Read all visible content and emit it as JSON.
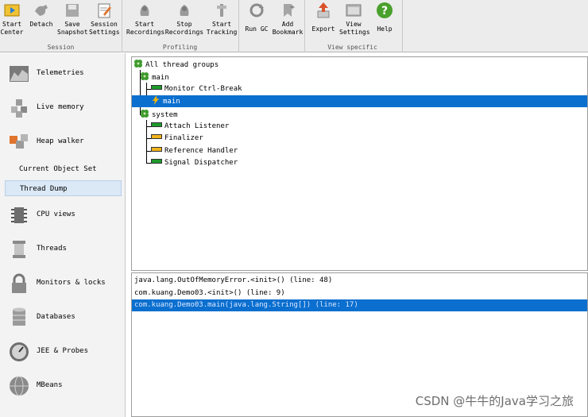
{
  "toolbar": {
    "groups": {
      "session": "Session",
      "profiling": "Profiling",
      "view_specific": "View specific"
    },
    "buttons": {
      "start_center": "Start\nCenter",
      "detach": "Detach",
      "save_snapshot": "Save\nSnapshot",
      "session_settings": "Session\nSettings",
      "start_recordings": "Start\nRecordings",
      "stop_recordings": "Stop\nRecordings",
      "start_tracking": "Start\nTracking",
      "run_gc": "Run GC",
      "add_bookmark": "Add\nBookmark",
      "export": "Export",
      "view_settings": "View\nSettings",
      "help": "Help"
    }
  },
  "sidebar": {
    "items": {
      "telemetries": "Telemetries",
      "live_memory": "Live memory",
      "heap_walker": "Heap walker",
      "current_object_set": "Current Object Set",
      "thread_dump": "Thread Dump",
      "cpu_views": "CPU views",
      "threads": "Threads",
      "monitors_locks": "Monitors & locks",
      "databases": "Databases",
      "jee_probes": "JEE & Probes",
      "mbeans": "MBeans"
    }
  },
  "tree": {
    "root": "All thread groups",
    "main_group": "main",
    "monitor_ctrl_break": "Monitor Ctrl-Break",
    "main_thread": "main",
    "system_group": "system",
    "attach_listener": "Attach Listener",
    "finalizer": "Finalizer",
    "reference_handler": "Reference Handler",
    "signal_dispatcher": "Signal Dispatcher",
    "state_colors": {
      "runnable": "#1d9a2a",
      "waiting": "#f0b31c"
    }
  },
  "stack": {
    "frames": [
      "java.lang.OutOfMemoryError.<init>() (line: 48)",
      "com.kuang.Demo03.<init>() (line: 9)",
      "com.kuang.Demo03.main(java.lang.String[]) (line: 17)"
    ],
    "selected_index": 2
  },
  "watermark": "CSDN @牛牛的Java学习之旅",
  "colors": {
    "selection": "#0a6fcf",
    "accent_red": "#d9532c",
    "help_green": "#4aa02c"
  }
}
